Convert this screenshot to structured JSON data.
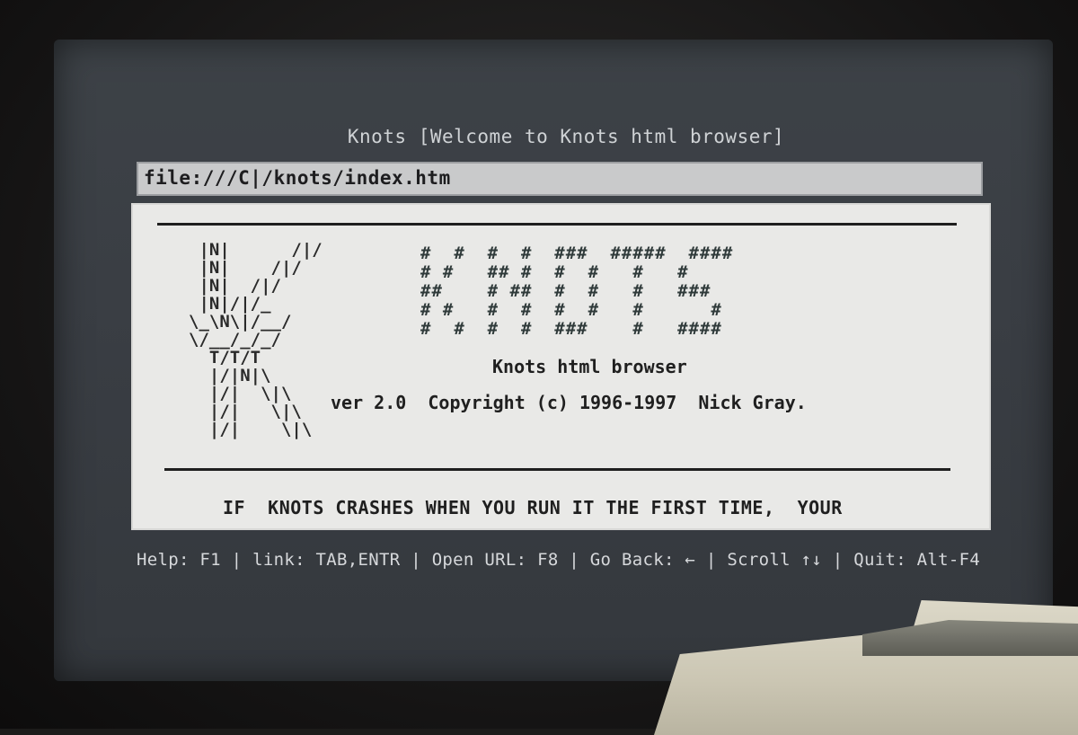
{
  "window": {
    "title": "Knots [Welcome to Knots html browser]"
  },
  "url_bar": {
    "value": "file:///C|/knots/index.htm"
  },
  "page": {
    "ascii_k_logo": " |N|      /|/\n |N|    /|/\n |N|  /|/\n |N|/|/_\n\\_\\N\\|/__/\n\\/__/_/_/\n  T/T/T\n  |/|N|\\\n  |/|  \\|\\\n  |/|   \\|\\\n  |/|    \\|\\",
    "ascii_knots_logo": "#  #  #  #  ###  #####  ####\n# #   ## #  #  #   #   #\n##    # ##  #  #   #   ###\n# #   #  #  #  #   #      #\n#  #  #  #  ###    #   ####",
    "subtitle": "Knots html browser",
    "copyright": "ver 2.0  Copyright (c) 1996-1997  Nick Gray.",
    "notice": "IF  KNOTS CRASHES WHEN YOU RUN IT THE FIRST TIME,  YOUR"
  },
  "status_bar": {
    "text": "Help: F1 | link: TAB,ENTR | Open URL: F8 | Go Back: ← | Scroll ↑↓ | Quit: Alt-F4"
  }
}
